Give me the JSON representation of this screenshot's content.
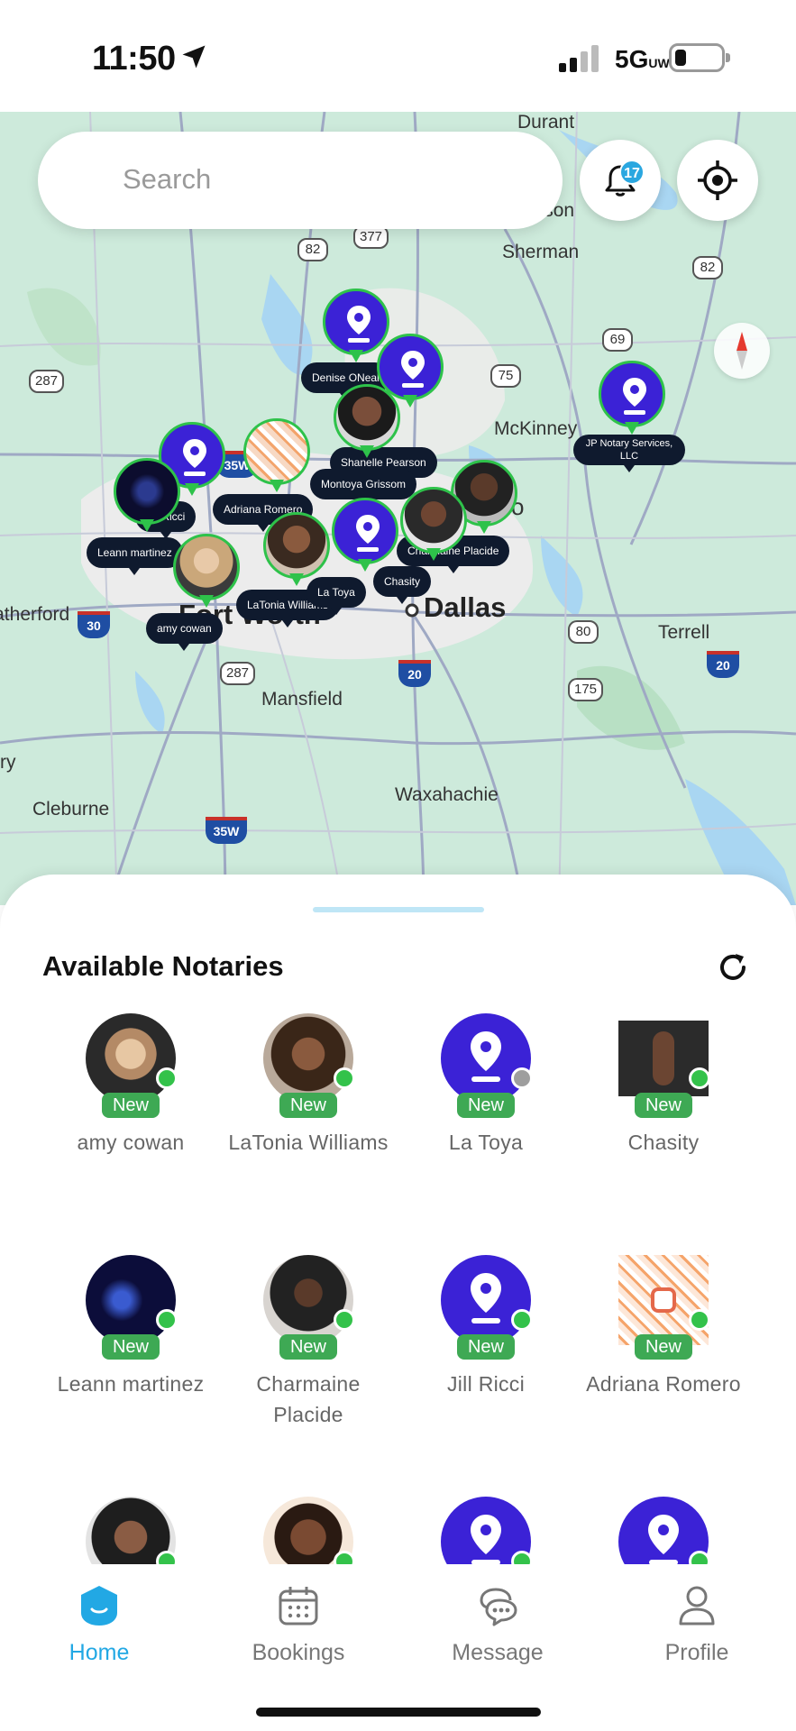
{
  "status": {
    "time": "11:50",
    "network": "5G",
    "network_sub": "UW"
  },
  "search": {
    "placeholder": "Search"
  },
  "notifications": {
    "count": "17"
  },
  "map": {
    "places": {
      "durant": "Durant",
      "denison": "Denison",
      "sherman": "Sherman",
      "mckinney": "McKinney",
      "plano": "Plano",
      "dallas": "Dallas",
      "fortworth": "Fort Worth",
      "weatherford": "Weatherford",
      "terrell": "Terrell",
      "mansfield": "Mansfield",
      "waxahachie": "Waxahachie",
      "cleburne": "Cleburne",
      "granbury": "Granbury"
    },
    "routes": {
      "r82a": "82",
      "r377": "377",
      "r82b": "82",
      "r69": "69",
      "r75": "75",
      "r287a": "287",
      "r287b": "287",
      "r80": "80",
      "r175": "175",
      "r20a": "20",
      "r20b": "20",
      "r30": "30",
      "r35w": "35W",
      "r35w2": "35W",
      "r75b": "75"
    },
    "pin_labels": {
      "denise": "Denise ONeal",
      "shanelle": "Shanelle Pearson",
      "montoya": "Montoya Grissom",
      "jill": "Jill Ricci",
      "adriana": "Adriana Romero",
      "leann": "Leann martinez",
      "latonia": "LaTonia Williams",
      "amy": "amy cowan",
      "latoya": "La Toya",
      "charmaine": "Charmaine Placide",
      "chasity": "Chasity",
      "jp": "JP Notary Services, LLC"
    }
  },
  "sheet": {
    "title": "Available Notaries",
    "new_label": "New",
    "notaries": [
      {
        "name": "amy cowan",
        "status": "online"
      },
      {
        "name": "LaTonia Williams",
        "status": "online"
      },
      {
        "name": "La Toya",
        "status": "offline"
      },
      {
        "name": "Chasity",
        "status": "online"
      },
      {
        "name": "Leann martinez",
        "status": "online"
      },
      {
        "name": "Charmaine Placide",
        "status": "online"
      },
      {
        "name": "Jill Ricci",
        "status": "online"
      },
      {
        "name": "Adriana Romero",
        "status": "online"
      }
    ]
  },
  "tabs": [
    {
      "label": "Home",
      "icon": "home-icon",
      "active": true
    },
    {
      "label": "Bookings",
      "icon": "calendar-icon",
      "active": false
    },
    {
      "label": "Message",
      "icon": "chat-bubbles-icon",
      "active": false
    },
    {
      "label": "Profile",
      "icon": "person-icon",
      "active": false
    }
  ],
  "colors": {
    "accent": "#22a8e4",
    "online": "#33c24a",
    "offline": "#9e9e9e",
    "pin": "#3b22d6",
    "new_tag": "#3ea954"
  }
}
